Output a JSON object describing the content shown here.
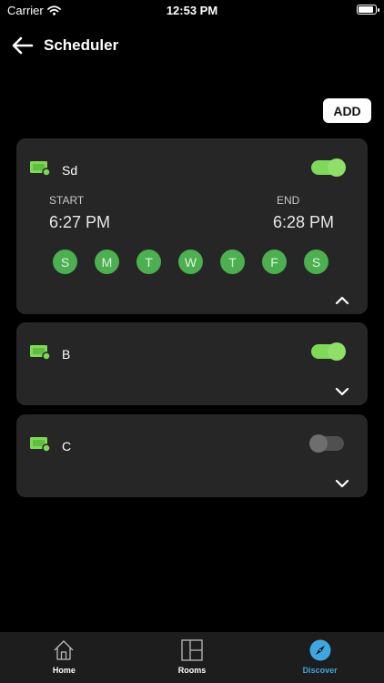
{
  "status_bar": {
    "carrier": "Carrier",
    "time": "12:53 PM",
    "battery_level": 0.9
  },
  "header": {
    "title": "Scheduler"
  },
  "add_label": "ADD",
  "schedules": [
    {
      "name": "Sd",
      "enabled": true,
      "expanded": true,
      "start_label": "START",
      "start_time": "6:27 PM",
      "end_label": "END",
      "end_time": "6:28 PM",
      "days": [
        "S",
        "M",
        "T",
        "W",
        "T",
        "F",
        "S"
      ]
    },
    {
      "name": "B",
      "enabled": true,
      "expanded": false
    },
    {
      "name": "C",
      "enabled": false,
      "expanded": false
    }
  ],
  "tabs": [
    {
      "label": "Home",
      "icon": "home-icon",
      "active": false
    },
    {
      "label": "Rooms",
      "icon": "rooms-icon",
      "active": false
    },
    {
      "label": "Discover",
      "icon": "compass-icon",
      "active": true
    }
  ],
  "colors": {
    "accent_green": "#7ed957",
    "day_green": "#4caf50",
    "active_tab": "#3ea6e0",
    "card_bg": "#262626"
  }
}
